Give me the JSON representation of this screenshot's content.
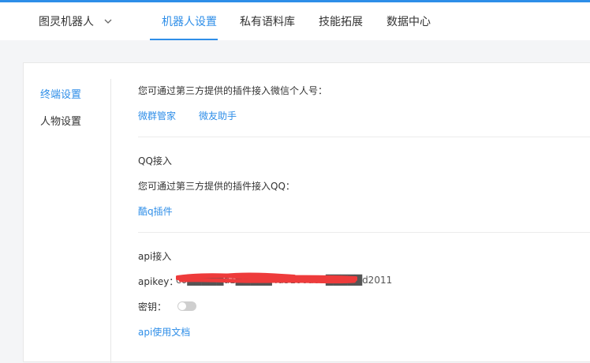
{
  "header": {
    "brand_label": "图灵机器人",
    "tabs": [
      {
        "label": "机器人设置",
        "active": true
      },
      {
        "label": "私有语料库",
        "active": false
      },
      {
        "label": "技能拓展",
        "active": false
      },
      {
        "label": "数据中心",
        "active": false
      }
    ]
  },
  "sidebar": {
    "items": [
      {
        "label": "终端设置",
        "active": true
      },
      {
        "label": "人物设置",
        "active": false
      }
    ]
  },
  "wechat": {
    "description": "您可通过第三方提供的插件接入微信个人号：",
    "links": [
      "微群管家",
      "微友助手"
    ]
  },
  "qq": {
    "title": "QQ接入",
    "description": "您可通过第三方提供的插件接入QQ：",
    "link": "酷q插件"
  },
  "api": {
    "title": "api接入",
    "apikey_label": "apikey：",
    "apikey_value": "c0█████d1█████4a5180a05█████d2011",
    "secret_label": "密钥：",
    "secret_enabled": false,
    "docs_link": "api使用文档"
  },
  "colors": {
    "accent": "#2e8ee8",
    "redaction": "#ee3b3b",
    "toggle_off": "#cfcfcf"
  }
}
